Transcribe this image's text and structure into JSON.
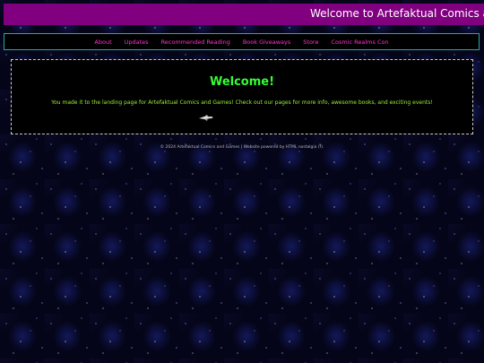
{
  "banner": {
    "text": "Welcome to Artefaktual Comics and Games!"
  },
  "nav": {
    "items": [
      {
        "label": "About"
      },
      {
        "label": "Updates"
      },
      {
        "label": "Recommended Reading"
      },
      {
        "label": "Book Giveaways"
      },
      {
        "label": "Store"
      },
      {
        "label": "Cosmic Realms Con"
      }
    ]
  },
  "main": {
    "title": "Welcome!",
    "text": "You made it to the landing page for Artefaktual Comics and Games! Check out our pages for more info, awesome books, and exciting events!",
    "image_icon": "spaceship-icon"
  },
  "footer": {
    "text": "© 2024 Artefaktual Comics and Games | Website powered by HTML nostalgia (f)."
  },
  "colors": {
    "banner_bg": "#800080",
    "nav_link": "#ff33cc",
    "nav_border": "#2aa6a6",
    "title": "#33ff33",
    "body_text": "#99ee33",
    "footer_text": "#b9b9b9"
  }
}
